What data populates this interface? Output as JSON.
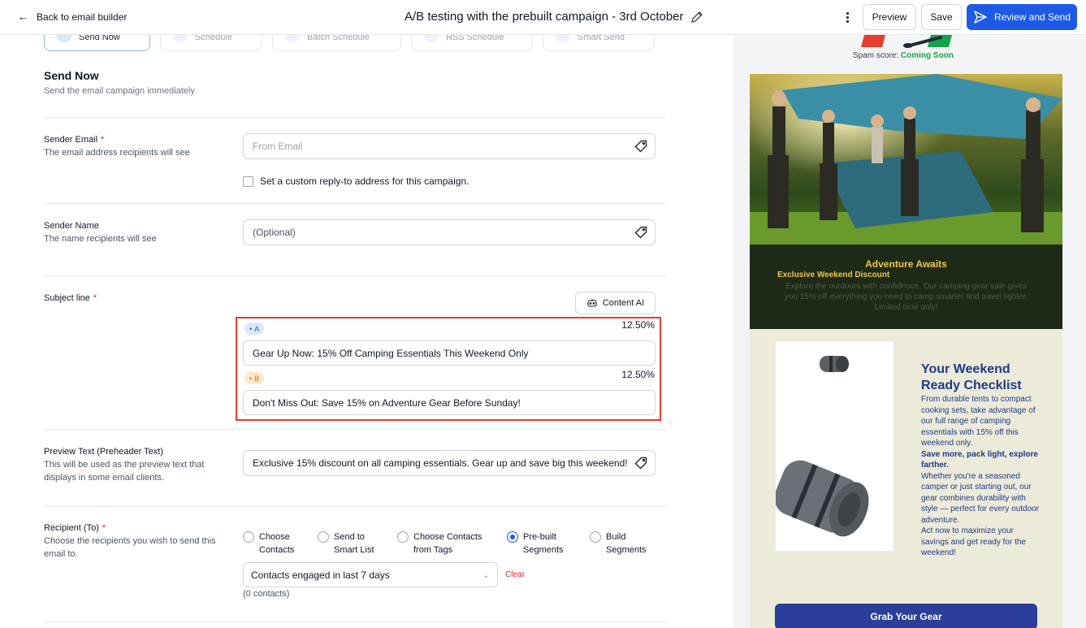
{
  "topbar": {
    "back_label": "Back to email builder",
    "title": "A/B testing with the prebuilt campaign - 3rd October",
    "preview_label": "Preview",
    "save_label": "Save",
    "review_send_label": "Review and Send"
  },
  "send_tabs": [
    "Send Now",
    "Schedule",
    "Batch Schedule",
    "RSS Schedule",
    "Smart Send"
  ],
  "section": {
    "title": "Send Now",
    "subtitle": "Send the email campaign immediately"
  },
  "sender_email": {
    "label": "Sender Email",
    "required": "*",
    "description": "The email address recipients will see",
    "placeholder": "From Email",
    "custom_reply_label": "Set a custom reply-to address for this campaign."
  },
  "sender_name": {
    "label": "Sender Name",
    "description": "The name recipients will see",
    "placeholder": "(Optional)"
  },
  "subject": {
    "label": "Subject line",
    "required": "*",
    "content_ai_label": "Content AI",
    "variant_a": {
      "badge": "A",
      "percent": "12.50%",
      "value": "Gear Up Now: 15% Off Camping Essentials This Weekend Only"
    },
    "variant_b": {
      "badge": "B",
      "percent": "12.50%",
      "value": "Don't Miss Out: Save 15% on Adventure Gear Before Sunday!"
    }
  },
  "preview_text": {
    "label": "Preview Text (Preheader Text)",
    "description": "This will be used as the preview text that displays in some email clients.",
    "value": "Exclusive 15% discount on all camping essentials. Gear up and save big this weekend!"
  },
  "recipient": {
    "label": "Recipient (To)",
    "required": "*",
    "description": "Choose the recipients you wish to send this email to.",
    "options": [
      {
        "line1": "Choose",
        "line2": "Contacts",
        "selected": false
      },
      {
        "line1": "Send to",
        "line2": "Smart List",
        "selected": false
      },
      {
        "line1": "Choose Contacts",
        "line2": "from Tags",
        "selected": false
      },
      {
        "line1": "Pre-built",
        "line2": "Segments",
        "selected": true
      },
      {
        "line1": "Build",
        "line2": "Segments",
        "selected": false
      }
    ],
    "segment_value": "Contacts engaged in last 7 days",
    "clear_label": "Clear",
    "count_text": "(0 contacts)"
  },
  "preview_panel": {
    "spam_label": "Spam score:",
    "spam_value": "Coming Soon",
    "hero_heading": "Adventure Awaits",
    "hero_sub": "Exclusive Weekend Discount",
    "hero_body": "Explore the outdoors with confidence. Our camping gear sale gives you 15% off everything you need to camp smarter and travel lighter. Limited time only!",
    "checklist_title": "Your Weekend Ready Checklist",
    "checklist_p1": "From durable tents to compact cooking sets, take advantage of our full range of camping essentials with 15% off this weekend only.",
    "checklist_bold": "Save more, pack light, explore farther.",
    "checklist_p2": "Whether you're a seasoned camper or just starting out, our gear combines durability with style — perfect for every outdoor adventure.",
    "checklist_p3": "Act now to maximize your savings and get ready for the weekend!",
    "cta_label": "Grab Your Gear"
  },
  "colors": {
    "accent": "#1f5ae6",
    "highlight_border": "#e53e2e",
    "required": "#dc2626",
    "hero_gold": "#f2c744",
    "checklist_navy": "#1e3a8a",
    "cta_bg": "#2a3f9a"
  }
}
